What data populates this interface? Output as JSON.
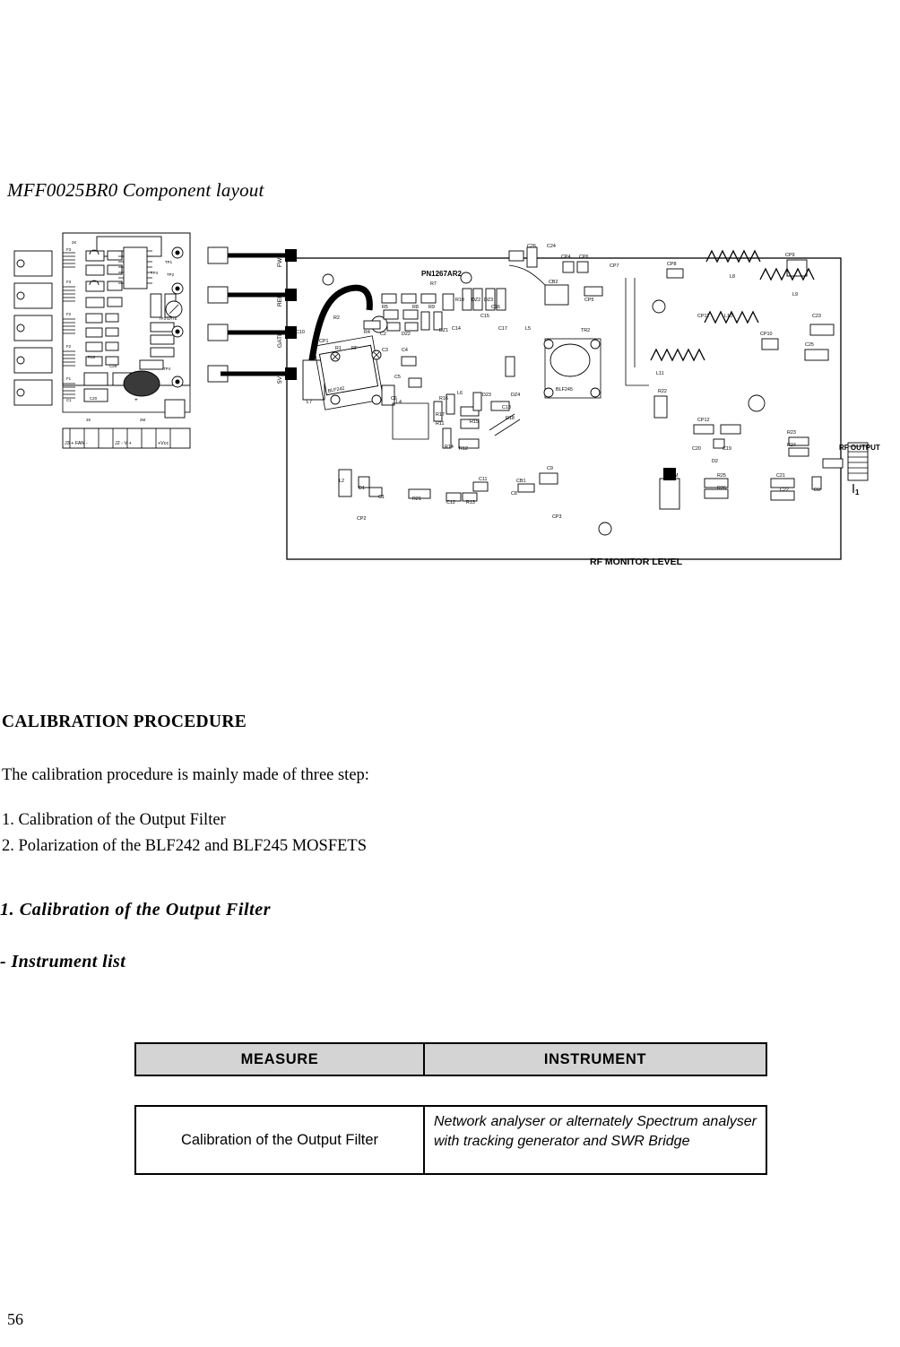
{
  "document": {
    "layout_title": "MFF0025BR0 Component layout",
    "section_title": "CALIBRATION PROCEDURE",
    "intro": "The calibration procedure is mainly made of three step:",
    "step_1": "1. Calibration of the Output Filter",
    "step_2": "2. Polarization of the BLF242 and BLF245 MOSFETS",
    "subsection_title": "1. Calibration of the Output Filter",
    "instrument_list_title": "- Instrument list",
    "page_number": "56"
  },
  "table": {
    "headers": [
      "MEASURE",
      "INSTRUMENT"
    ],
    "rows": [
      {
        "measure": "Calibration of the Output Filter",
        "instrument": "Network analyser or alternately Spectrum analyser with tracking generator and SWR Bridge"
      }
    ]
  },
  "figure": {
    "board_label": "PN1267AR2",
    "rf_output_label": "RF OUTPUT",
    "rf_monitor_label": "RF MONITOR LEVEL",
    "signal_labels": [
      "FWD",
      "REF",
      "GATE",
      "5V"
    ],
    "left_board_bottom_labels": [
      "J3  + FAN -",
      "J2   - V +",
      "+Vcc"
    ],
    "left_board_refs": [
      "TP1",
      "TP2",
      "TP3",
      "TP4",
      "TP5",
      "GATE",
      "C1",
      "C2"
    ],
    "transistors": [
      "BLF242",
      "BLF245"
    ],
    "main_refs": [
      "C24",
      "C26",
      "CP4",
      "CP6",
      "CP7",
      "CP8",
      "CP5",
      "CB2",
      "L8",
      "CP9",
      "CP11",
      "L10",
      "L9",
      "C23",
      "CP10",
      "C25",
      "TR2",
      "L5",
      "L11",
      "R22",
      "CP12",
      "C20",
      "C19",
      "D2",
      "R23",
      "R24",
      "R25",
      "R26",
      "C21",
      "C22",
      "D3",
      "CP3",
      "C8",
      "CB1",
      "C9",
      "C11",
      "C12",
      "R13",
      "R21",
      "C1",
      "D1",
      "L2",
      "CP2",
      "L7",
      "R12",
      "R14",
      "R11",
      "R17",
      "R16",
      "R15",
      "R18",
      "C13",
      "DZ4",
      "D23",
      "L6",
      "L4",
      "C6",
      "C5",
      "C4",
      "C3",
      "C2",
      "D22",
      "R4",
      "R1",
      "RF",
      "R2",
      "C10",
      "CP1",
      "R5",
      "R8",
      "R9",
      "R10",
      "R7",
      "DZ1",
      "C14",
      "C15",
      "C16",
      "C17",
      "DZ2",
      "DZ3",
      "M"
    ]
  }
}
